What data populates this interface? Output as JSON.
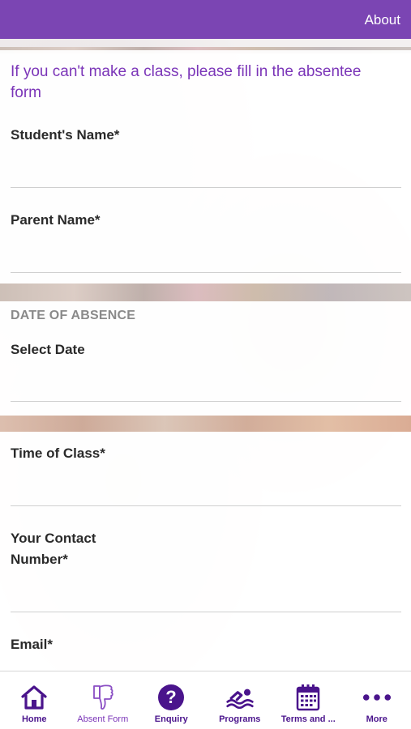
{
  "header": {
    "about_label": "About"
  },
  "form": {
    "intro": "If you can't make a class, please fill in the absentee form",
    "student_name_label": "Student's Name*",
    "parent_name_label": "Parent Name*",
    "date_section_header": "DATE OF ABSENCE",
    "select_date_label": "Select Date",
    "time_of_class_label": "Time of Class*",
    "contact_number_label_line1": "Your Contact",
    "contact_number_label_line2": "Number*",
    "email_label": "Email*"
  },
  "tabbar": {
    "items": [
      {
        "label": "Home",
        "icon": "home-icon",
        "active": false
      },
      {
        "label": "Absent Form",
        "icon": "thumbs-down-icon",
        "active": true
      },
      {
        "label": "Enquiry",
        "icon": "question-icon",
        "active": false
      },
      {
        "label": "Programs",
        "icon": "swimmer-icon",
        "active": false
      },
      {
        "label": "Terms and ...",
        "icon": "calendar-icon",
        "active": false
      },
      {
        "label": "More",
        "icon": "more-dots-icon",
        "active": false
      }
    ]
  },
  "colors": {
    "brand": "#7b45b3",
    "tab_icon": "#4a148c",
    "active_tab": "#7b35b8"
  }
}
